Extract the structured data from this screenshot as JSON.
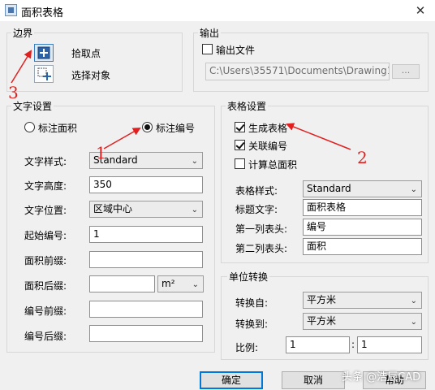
{
  "window": {
    "title": "面积表格",
    "close_glyph": "✕"
  },
  "boundary": {
    "legend": "边界",
    "pick_point_label": "拾取点",
    "select_object_label": "选择对象"
  },
  "output": {
    "legend": "输出",
    "output_file_label": "输出文件",
    "output_file_checked": false,
    "path_value": "C:\\Users\\35571\\Documents\\Drawing1_",
    "browse_label": "..."
  },
  "text_settings": {
    "legend": "文字设置",
    "radio_area_label": "标注面积",
    "radio_number_label": "标注编号",
    "selected_radio": "标注编号",
    "style_label": "文字样式:",
    "style_value": "Standard",
    "height_label": "文字高度:",
    "height_value": "350",
    "position_label": "文字位置:",
    "position_value": "区域中心",
    "start_number_label": "起始编号:",
    "start_number_value": "1",
    "area_prefix_label": "面积前缀:",
    "area_prefix_value": "",
    "area_suffix_label": "面积后缀:",
    "area_suffix_value": "",
    "area_unit_value": "m²",
    "number_prefix_label": "编号前缀:",
    "number_prefix_value": "",
    "number_suffix_label": "编号后缀:",
    "number_suffix_value": ""
  },
  "table_settings": {
    "legend": "表格设置",
    "generate_table_label": "生成表格",
    "generate_table_checked": true,
    "link_number_label": "关联编号",
    "link_number_checked": true,
    "total_area_label": "计算总面积",
    "total_area_checked": false,
    "table_style_label": "表格样式:",
    "table_style_value": "Standard",
    "title_text_label": "标题文字:",
    "title_text_value": "面积表格",
    "col1_header_label": "第一列表头:",
    "col1_header_value": "编号",
    "col2_header_label": "第二列表头:",
    "col2_header_value": "面积"
  },
  "unit_conversion": {
    "legend": "单位转换",
    "from_label": "转换自:",
    "from_value": "平方米",
    "to_label": "转换到:",
    "to_value": "平方米",
    "ratio_label": "比例:",
    "ratio_left_value": "1",
    "ratio_colon": ":",
    "ratio_right_value": "1"
  },
  "buttons": {
    "ok_label": "确定",
    "cancel_label": "取消",
    "help_label": "帮助"
  },
  "annotations": {
    "num1": "1",
    "num2": "2",
    "num3": "3",
    "arrow_color": "#e02020"
  },
  "watermark": "头条 @浩辰CAD"
}
